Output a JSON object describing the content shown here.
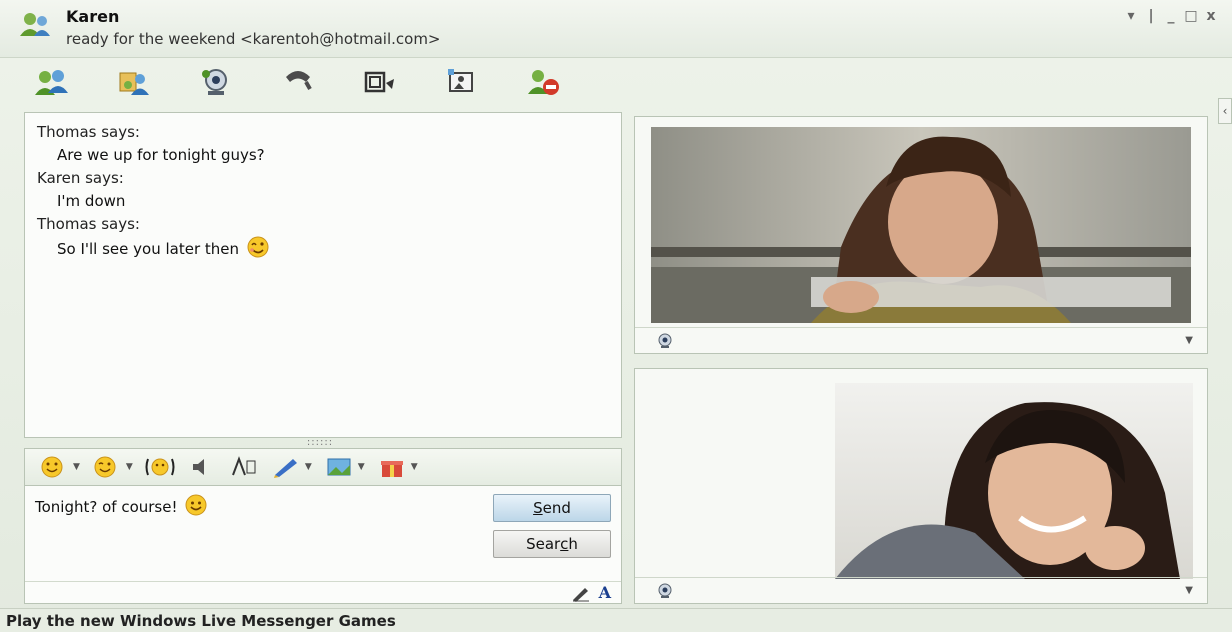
{
  "window": {
    "contact_name": "Karen",
    "contact_status": "ready for the weekend <karentoh@hotmail.com>",
    "controls": [
      "▾",
      "|",
      "_",
      "□",
      "x"
    ]
  },
  "toolbar": {
    "items": [
      {
        "icon": "invite-contact-icon"
      },
      {
        "icon": "share-files-icon"
      },
      {
        "icon": "video-call-icon"
      },
      {
        "icon": "phone-call-icon"
      },
      {
        "icon": "activities-icon"
      },
      {
        "icon": "games-icon"
      },
      {
        "icon": "block-contact-icon"
      }
    ]
  },
  "conversation": {
    "messages": [
      {
        "sender": "Thomas says:",
        "text": "Are we up for tonight guys?",
        "emoticon": false
      },
      {
        "sender": "Karen says:",
        "text": "I'm down",
        "emoticon": false
      },
      {
        "sender": "Thomas says:",
        "text": "So I'll see you later then",
        "emoticon": true
      }
    ]
  },
  "format_toolbar": {
    "items": [
      "emoticon-icon",
      "wink-icon",
      "nudge-icon",
      "voice-clip-icon",
      "font-icon",
      "handwriting-icon",
      "background-icon",
      "gift-icon"
    ]
  },
  "input": {
    "value": "Tonight? of course!",
    "send_label_first": "S",
    "send_label_rest": "end",
    "search_label_pre": "Sear",
    "search_label_under": "c",
    "search_label_post": "h",
    "footer_font_glyph": "A"
  },
  "ad": {
    "text": "Play the new Windows Live Messenger Games"
  },
  "colors": {
    "accent": "#1b3f8f",
    "send_button": "#bcd6e8"
  }
}
